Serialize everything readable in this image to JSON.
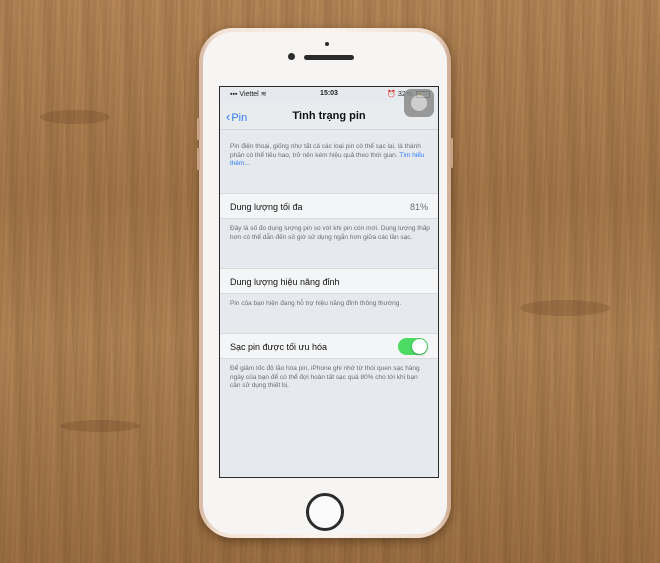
{
  "status_bar": {
    "carrier": "Viettel",
    "time": "15:03",
    "battery_percent": "32%",
    "wifi_icon": "wifi-icon",
    "alarm_icon": "alarm-icon"
  },
  "nav": {
    "back_label": "Pin",
    "title": "Tình trạng pin"
  },
  "intro": {
    "text": "Pin điện thoại, giống như tất cả các loại pin có thể sạc lại, là thành phần có thể tiêu hao, trở nên kém hiệu quả theo thời gian.",
    "link": "Tìm hiểu thêm..."
  },
  "max_capacity": {
    "label": "Dung lượng tối đa",
    "value": "81%",
    "footnote": "Đây là số đo dung lượng pin so với khi pin còn mới. Dung lượng thấp hơn có thể dẫn đến số giờ sử dụng ngắn hơn giữa các lần sạc."
  },
  "peak_performance": {
    "label": "Dung lượng hiệu năng đỉnh",
    "footnote": "Pin của bạn hiện đang hỗ trợ hiệu năng đỉnh thông thường."
  },
  "optimized_charging": {
    "label": "Sạc pin được tối ưu hóa",
    "enabled": true,
    "footnote": "Để giảm tốc độ lão hóa pin, iPhone ghi nhớ từ thói quen sạc hàng ngày của bạn để có thể đợi hoàn tất sạc quá 80% cho tới khi bạn cần sử dụng thiết bị."
  },
  "colors": {
    "accent": "#2f7bf5",
    "toggle_on": "#4cd964"
  }
}
